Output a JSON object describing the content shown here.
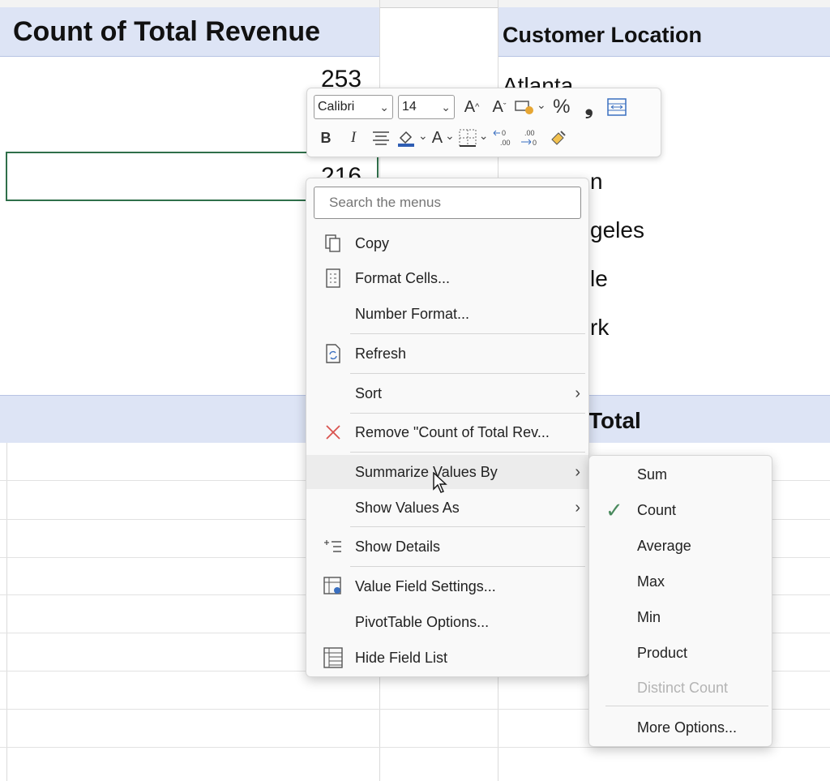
{
  "sheet": {
    "header_left": "Count of Total Revenue",
    "header_right": "Customer Location",
    "values": [
      "253",
      "216"
    ],
    "locations_partial": [
      "Atlanta",
      "n",
      "geles",
      "le",
      "rk"
    ],
    "total_partial": "Total"
  },
  "mini_toolbar": {
    "font_name": "Calibri",
    "font_size": "14",
    "bold": "B",
    "italic": "I",
    "percent": "%",
    "comma": "❟",
    "grow_font": "A",
    "shrink_font": "A",
    "font_color": "A"
  },
  "context_menu": {
    "search_placeholder": "Search the menus",
    "items": {
      "copy": "Copy",
      "format_cells": "Format Cells...",
      "number_format": "Number Format...",
      "refresh": "Refresh",
      "sort": "Sort",
      "remove": "Remove \"Count of Total Rev...",
      "summarize": "Summarize Values By",
      "show_values_as": "Show Values As",
      "show_details": "Show Details",
      "value_field_settings": "Value Field Settings...",
      "pivot_options": "PivotTable Options...",
      "hide_field_list": "Hide Field List"
    }
  },
  "submenu": {
    "sum": "Sum",
    "count": "Count",
    "average": "Average",
    "max": "Max",
    "min": "Min",
    "product": "Product",
    "distinct_count": "Distinct Count",
    "more_options": "More Options...",
    "checked": "count"
  },
  "colors": {
    "header_band": "#dde4f5",
    "selection_border": "#2f6f4a",
    "remove_icon": "#d9534f",
    "check": "#4a8a5e",
    "font_color_bar": "#2e5db3"
  }
}
